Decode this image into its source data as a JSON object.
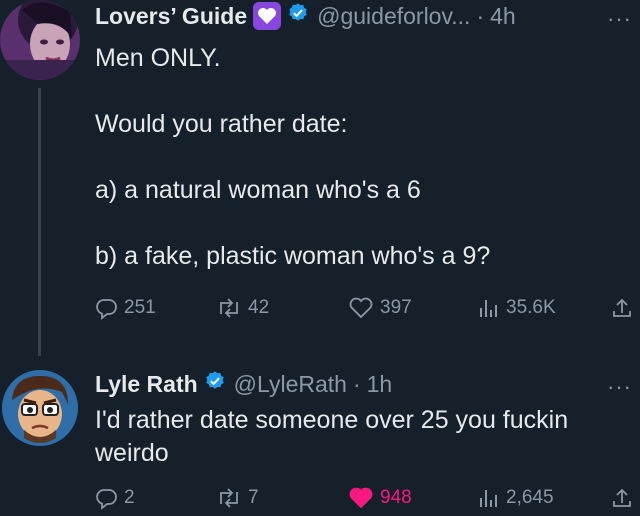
{
  "tweets": [
    {
      "display_name": "Lovers’ Guide",
      "handle": "@guideforlov...",
      "time": "4h",
      "text_lines": [
        "Men ONLY.",
        "",
        "Would you rather date:",
        "",
        "a) a natural woman who's a 6",
        "",
        "b) a fake, plastic woman who's a 9?"
      ],
      "replies": "251",
      "retweets": "42",
      "likes": "397",
      "views": "35.6K",
      "liked": false
    },
    {
      "display_name": "Lyle Rath",
      "handle": "@LyleRath",
      "time": "1h",
      "text_lines": [
        "I'd rather date someone over 25 you fuckin",
        "weirdo"
      ],
      "replies": "2",
      "retweets": "7",
      "likes": "948",
      "views": "2,645",
      "liked": true
    }
  ],
  "separator": "·",
  "more_label": "···",
  "colors": {
    "background": "#15202b",
    "text": "#e7e9ea",
    "muted": "#8b98a5",
    "verified_blue": "#1d9bf0",
    "like_pink": "#f91880",
    "badge_purple": "#8a47e0"
  },
  "icons": [
    "reply-icon",
    "retweet-icon",
    "like-icon",
    "views-icon",
    "share-icon",
    "verified-icon",
    "heart-badge-icon"
  ]
}
